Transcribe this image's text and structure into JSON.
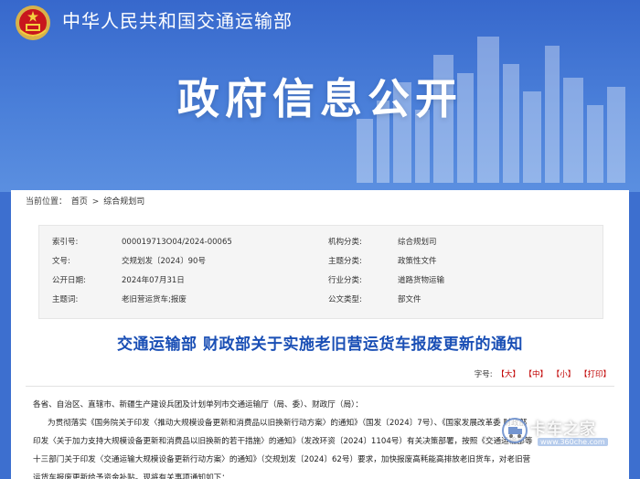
{
  "header": {
    "ministry_name": "中华人民共和国交通运输部",
    "banner_title": "政府信息公开"
  },
  "breadcrumb": {
    "prefix": "当前位置：",
    "items": [
      "首页",
      "综合规划司"
    ],
    "separator": ">"
  },
  "meta": {
    "rows": [
      {
        "label1": "索引号:",
        "value1": "000019713O04/2024-00065",
        "label2": "机构分类:",
        "value2": "综合规划司"
      },
      {
        "label1": "文号:",
        "value1": "交规划发〔2024〕90号",
        "label2": "主题分类:",
        "value2": "政策性文件"
      },
      {
        "label1": "公开日期:",
        "value1": "2024年07月31日",
        "label2": "行业分类:",
        "value2": "道路货物运输"
      },
      {
        "label1": "主题词:",
        "value1": "老旧营运货车;报废",
        "label2": "公文类型:",
        "value2": "部文件"
      }
    ]
  },
  "document": {
    "title": "交通运输部 财政部关于实施老旧营运货车报废更新的通知",
    "font_size_label": "字号:",
    "size_large": "【大】",
    "size_medium": "【中】",
    "size_small": "【小】",
    "print": "【打印】",
    "body_lines": [
      "各省、自治区、直辖市、新疆生产建设兵团及计划单列市交通运输厅（局、委）、财政厅（局）：",
      "为贯彻落实《国务院关于印发〈推动大规模设备更新和消费品以旧换新行动方案〉的通知》（国发〔2024〕7号）、《国家发展改革委 财政部",
      "印发〈关于加力支持大规模设备更新和消费品以旧换新的若干措施〉的通知》（发改环资〔2024〕1104号）有关决策部署，按照《交通运输部等",
      "十三部门关于印发〈交通运输大规模设备更新行动方案〉的通知》（交规划发〔2024〕62号）要求，加快报废高耗能高排放老旧货车，对老旧营",
      "运货车报废更新给予资金补贴。现将有关事项通知如下："
    ]
  },
  "watermark": {
    "text": "卡车之家",
    "url": "www.360che.com"
  },
  "colors": {
    "banner_blue": "#3d6fcf",
    "title_blue": "#1a4fb5",
    "size_red": "#c00000"
  }
}
